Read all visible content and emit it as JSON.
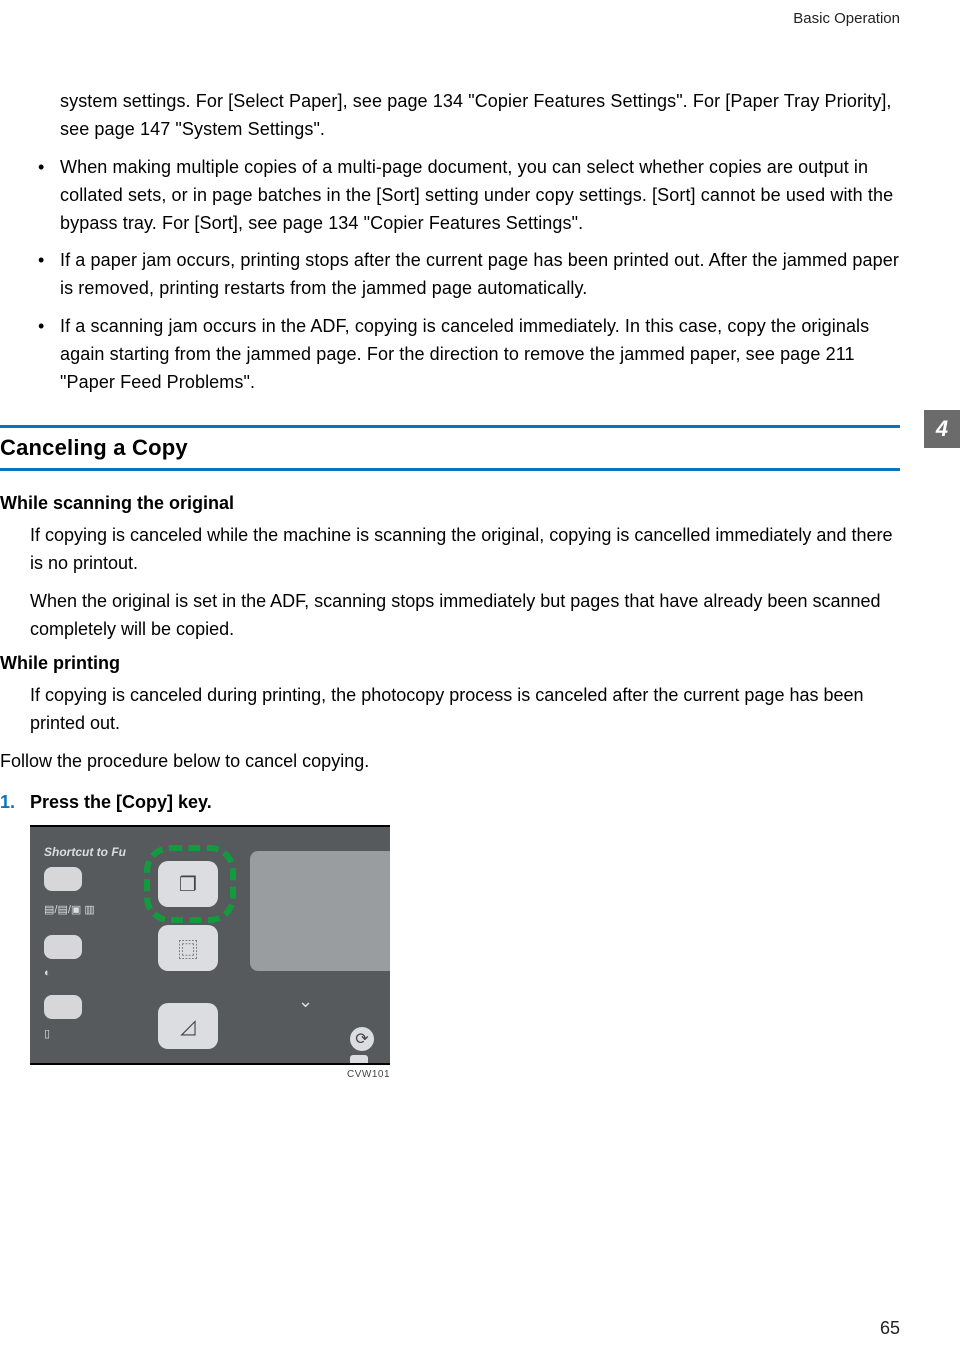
{
  "header": {
    "running": "Basic Operation"
  },
  "thumb_tab": "4",
  "intro": {
    "continued": "system settings. For [Select Paper], see page 134 \"Copier Features Settings\". For [Paper Tray Priority], see page 147 \"System Settings\".",
    "bullets": [
      "When making multiple copies of a multi-page document, you can select whether copies are output in collated sets, or in page batches in the [Sort] setting under copy settings. [Sort] cannot be used with the bypass tray. For [Sort], see page 134 \"Copier Features Settings\".",
      "If a paper jam occurs, printing stops after the current page has been printed out. After the jammed paper is removed, printing restarts from the jammed page automatically.",
      "If a scanning jam occurs in the ADF, copying is canceled immediately. In this case, copy the originals again starting from the jammed page. For the direction to remove the jammed paper, see page 211 \"Paper Feed Problems\"."
    ]
  },
  "section": {
    "heading": "Canceling a Copy",
    "sub1": {
      "title": "While scanning the original",
      "p1": "If copying is canceled while the machine is scanning the original, copying is cancelled immediately and there is no printout.",
      "p2": "When the original is set in the ADF, scanning stops immediately but pages that have already been scanned completely will be copied."
    },
    "sub2": {
      "title": "While printing",
      "p1": "If copying is canceled during printing, the photocopy process is canceled after the current page has been printed out."
    },
    "lead": "Follow the procedure below to cancel copying.",
    "steps": [
      {
        "num": "1.",
        "text": "Press the [Copy] key."
      }
    ]
  },
  "figure": {
    "shortcut_label": "Shortcut to Fu",
    "left_icon_strip": "▤/▤/▣ ▥",
    "contrast_icon": "◐",
    "tray_icon": "▯",
    "mid_icon_1": "❐",
    "mid_icon_2": "⿴",
    "mid_icon_3": "◿",
    "chevron": "⌄",
    "refresh": "⟳",
    "caption": "CVW101"
  },
  "page_number": "65"
}
